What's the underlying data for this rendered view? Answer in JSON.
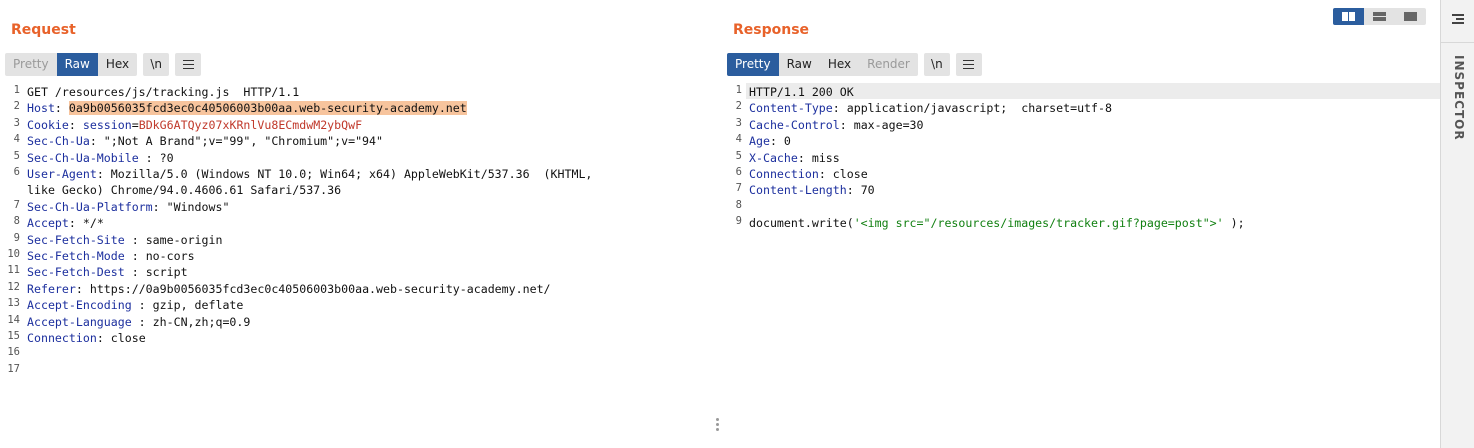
{
  "request": {
    "title": "Request",
    "tabs": [
      "Pretty",
      "Raw",
      "Hex"
    ],
    "active_tab": "Raw",
    "newline_toggle": "\\n",
    "lines": [
      {
        "n": "1",
        "key": "GET /resources/js/tracking.js  HTTP/1.1",
        "sep": "",
        "val": ""
      },
      {
        "n": "2",
        "key": "Host",
        "sep": ": ",
        "val": "0a9b0056035fcd3ec0c40506003b00aa.web-security-academy.net"
      },
      {
        "n": "3",
        "key": "Cookie",
        "sep": ": ",
        "cookie_name": "session",
        "cookie_val": "BDkG6ATQyz07xKRnlVu8ECmdwM2ybQwF"
      },
      {
        "n": "4",
        "key": "Sec-Ch-Ua",
        "sep": ": ",
        "val": "\";Not A Brand\";v=\"99\", \"Chromium\";v=\"94\""
      },
      {
        "n": "5",
        "key": "Sec-Ch-Ua-Mobile",
        "sep": " : ",
        "val": "?0"
      },
      {
        "n": "6",
        "key": "User-Agent",
        "sep": ": ",
        "val": "Mozilla/5.0 (Windows NT 10.0; Win64; x64) AppleWebKit/537.36  (KHTML,"
      },
      {
        "n": "",
        "key": "",
        "sep": "",
        "val": "like Gecko) Chrome/94.0.4606.61 Safari/537.36"
      },
      {
        "n": "7",
        "key": "Sec-Ch-Ua-Platform",
        "sep": ": ",
        "val": "\"Windows\""
      },
      {
        "n": "8",
        "key": "Accept",
        "sep": ": ",
        "val": "*/*"
      },
      {
        "n": "9",
        "key": "Sec-Fetch-Site",
        "sep": " : ",
        "val": "same-origin"
      },
      {
        "n": "10",
        "key": "Sec-Fetch-Mode",
        "sep": " : ",
        "val": "no-cors"
      },
      {
        "n": "11",
        "key": "Sec-Fetch-Dest",
        "sep": " : ",
        "val": "script"
      },
      {
        "n": "12",
        "key": "Referer",
        "sep": ": ",
        "val": "https://0a9b0056035fcd3ec0c40506003b00aa.web-security-academy.net/"
      },
      {
        "n": "13",
        "key": "Accept-Encoding",
        "sep": " : ",
        "val": "gzip, deflate"
      },
      {
        "n": "14",
        "key": "Accept-Language",
        "sep": " : ",
        "val": "zh-CN,zh;q=0.9"
      },
      {
        "n": "15",
        "key": "Connection",
        "sep": ": ",
        "val": "close"
      },
      {
        "n": "16",
        "key": "",
        "sep": "",
        "val": ""
      },
      {
        "n": "17",
        "key": "",
        "sep": "",
        "val": ""
      }
    ]
  },
  "response": {
    "title": "Response",
    "tabs": [
      "Pretty",
      "Raw",
      "Hex",
      "Render"
    ],
    "active_tab": "Pretty",
    "newline_toggle": "\\n",
    "lines": [
      {
        "n": "1",
        "key": "HTTP/1.1 200 OK",
        "sep": "",
        "val": ""
      },
      {
        "n": "2",
        "key": "Content-Type",
        "sep": ": ",
        "val": "application/javascript;  charset=utf-8"
      },
      {
        "n": "3",
        "key": "Cache-Control",
        "sep": ": ",
        "val": "max-age=30"
      },
      {
        "n": "4",
        "key": "Age",
        "sep": ": ",
        "val": "0"
      },
      {
        "n": "5",
        "key": "X-Cache",
        "sep": ": ",
        "val": "miss"
      },
      {
        "n": "6",
        "key": "Connection",
        "sep": ": ",
        "val": "close"
      },
      {
        "n": "7",
        "key": "Content-Length",
        "sep": ": ",
        "val": "70"
      },
      {
        "n": "8",
        "key": "",
        "sep": "",
        "val": ""
      },
      {
        "n": "9",
        "code_pre": "document.write(",
        "code_str": "'<img src=\"/resources/images/tracker.gif?page=post\">'",
        "code_post": " );"
      }
    ]
  },
  "inspector": {
    "label": "INSPECTOR"
  },
  "layout_views": [
    "side-by-side",
    "stacked",
    "tabs"
  ],
  "colors": {
    "accent": "#e8622a",
    "active": "#2b5d9e",
    "header_key": "#1c2f9e",
    "cookie_value": "#c0392b",
    "string": "#118011",
    "highlight": "#f7c49d"
  }
}
